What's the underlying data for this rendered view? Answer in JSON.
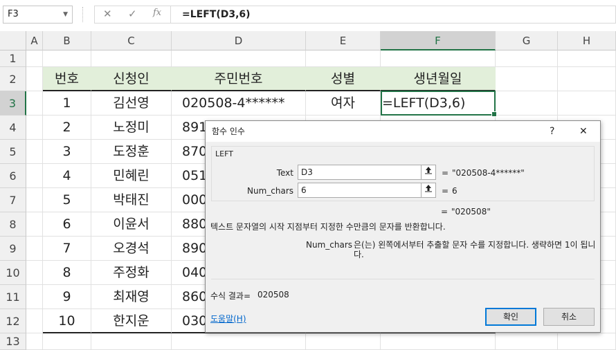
{
  "formula_bar": {
    "name_box": "F3",
    "cancel_glyph": "✕",
    "enter_glyph": "✓",
    "fx_glyph": "fx",
    "formula": "=LEFT(D3,6)"
  },
  "columns": [
    "A",
    "B",
    "C",
    "D",
    "E",
    "F",
    "G",
    "H"
  ],
  "rows": [
    "1",
    "2",
    "3",
    "4",
    "5",
    "6",
    "7",
    "8",
    "9",
    "10",
    "11",
    "12",
    "13"
  ],
  "header_row": {
    "b": "번호",
    "c": "신청인",
    "d": "주민번호",
    "e": "성별",
    "f": "생년월일"
  },
  "table": [
    {
      "b": "1",
      "c": "김선영",
      "d": "020508-4******",
      "e": "여자",
      "f": "=LEFT(D3,6)"
    },
    {
      "b": "2",
      "c": "노정미",
      "d": "891",
      "e": "",
      "f": ""
    },
    {
      "b": "3",
      "c": "도정훈",
      "d": "870",
      "e": "",
      "f": ""
    },
    {
      "b": "4",
      "c": "민혜린",
      "d": "051",
      "e": "",
      "f": ""
    },
    {
      "b": "5",
      "c": "박태진",
      "d": "000",
      "e": "",
      "f": ""
    },
    {
      "b": "6",
      "c": "이윤서",
      "d": "880",
      "e": "",
      "f": ""
    },
    {
      "b": "7",
      "c": "오경석",
      "d": "890",
      "e": "",
      "f": ""
    },
    {
      "b": "8",
      "c": "주정화",
      "d": "040",
      "e": "",
      "f": ""
    },
    {
      "b": "9",
      "c": "최재영",
      "d": "860",
      "e": "",
      "f": ""
    },
    {
      "b": "10",
      "c": "한지운",
      "d": "030",
      "e": "",
      "f": ""
    }
  ],
  "dialog": {
    "title": "함수 인수",
    "help_glyph": "?",
    "close_glyph": "✕",
    "function_name": "LEFT",
    "args": [
      {
        "label": "Text",
        "value": "D3",
        "result": "\"020508-4******\""
      },
      {
        "label": "Num_chars",
        "value": "6",
        "result": "6"
      }
    ],
    "equals": "=",
    "function_result": "\"020508\"",
    "description": "텍스트 문자열의 시작 지점부터 지정한 수만큼의 문자를 반환합니다.",
    "arg_help_label": "Num_chars",
    "arg_help_text": "은(는) 왼쪽에서부터 추출할 문자 수를 지정합니다. 생략하면 1이 됩니다.",
    "formula_result_label": "수식 결과=",
    "formula_result_value": "020508",
    "help_link": "도움말(H)",
    "ok": "확인",
    "cancel": "취소"
  }
}
